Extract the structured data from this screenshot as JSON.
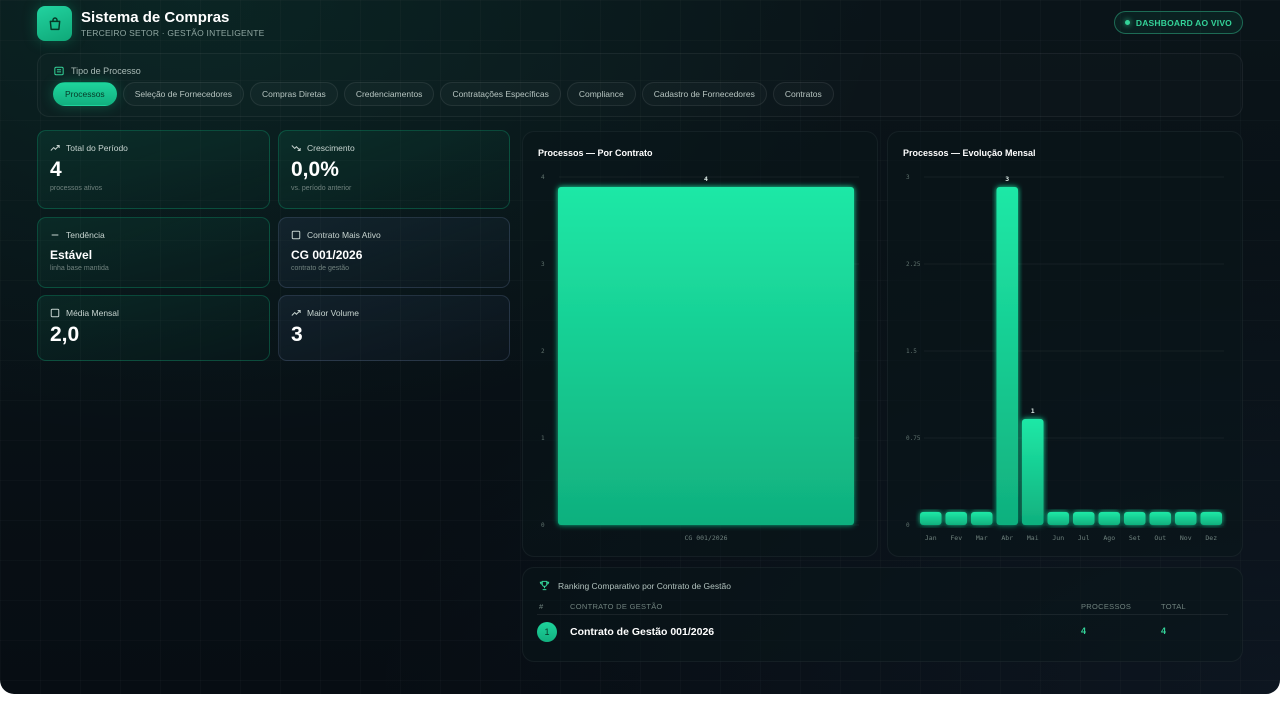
{
  "app": {
    "title": "Sistema de Compras",
    "subtitle": "TERCEIRO SETOR · GESTÃO INTELIGENTE",
    "live_badge": "DASHBOARD AO VIVO",
    "accent": "#10b981"
  },
  "process_type": {
    "label": "Tipo de Processo",
    "tabs": [
      {
        "label": "Processos",
        "active": true
      },
      {
        "label": "Seleção de Fornecedores",
        "active": false
      },
      {
        "label": "Compras Diretas",
        "active": false
      },
      {
        "label": "Credenciamentos",
        "active": false
      },
      {
        "label": "Contratações Específicas",
        "active": false
      },
      {
        "label": "Compliance",
        "active": false
      },
      {
        "label": "Cadastro de Fornecedores",
        "active": false
      },
      {
        "label": "Contratos",
        "active": false
      }
    ]
  },
  "stats": [
    {
      "icon": "trend-up-icon",
      "label": "Total do Período",
      "value": "4",
      "sub": "processos ativos"
    },
    {
      "icon": "trend-down-icon",
      "label": "Crescimento",
      "value": "0,0%",
      "sub": "vs. período anterior"
    },
    {
      "icon": "minus-icon",
      "label": "Tendência",
      "value": "Estável",
      "sub": "linha base mantida"
    },
    {
      "icon": "document-icon",
      "label": "Contrato Mais Ativo",
      "value": "CG 001/2026",
      "sub": "contrato de gestão"
    },
    {
      "icon": "calendar-icon",
      "label": "Média Mensal",
      "value": "2,0",
      "sub": ""
    },
    {
      "icon": "trend-up-icon",
      "label": "Maior Volume",
      "value": "3",
      "sub": ""
    }
  ],
  "chart_data": [
    {
      "type": "bar",
      "title": "Processos — Por Contrato",
      "categories": [
        "CG 001/2026"
      ],
      "values": [
        4
      ],
      "yticks": [
        "0",
        "1",
        "2",
        "3",
        "4"
      ],
      "ylim": [
        0,
        4
      ],
      "data_labels": [
        "4"
      ],
      "grid": true
    },
    {
      "type": "bar",
      "title": "Processos — Evolução Mensal",
      "categories": [
        "Jan",
        "Fev",
        "Mar",
        "Abr",
        "Mai",
        "Jun",
        "Jul",
        "Ago",
        "Set",
        "Out",
        "Nov",
        "Dez"
      ],
      "values": [
        0,
        0,
        0,
        3,
        1,
        0,
        0,
        0,
        0,
        0,
        0,
        0
      ],
      "yticks": [
        "0",
        "0.75",
        "1.5",
        "2.25",
        "3"
      ],
      "ylim": [
        0,
        3
      ],
      "data_labels": [
        "",
        "",
        "",
        "3",
        "1",
        "",
        "",
        "",
        "",
        "",
        "",
        ""
      ],
      "grid": true
    }
  ],
  "ranking": {
    "title": "Ranking Comparativo por Contrato de Gestão",
    "columns": {
      "rank": "#",
      "contract": "CONTRATO DE GESTÃO",
      "processes": "PROCESSOS",
      "total": "TOTAL"
    },
    "rows": [
      {
        "rank": "1",
        "contract": "Contrato de Gestão 001/2026",
        "processes": "4",
        "total": "4"
      }
    ]
  }
}
